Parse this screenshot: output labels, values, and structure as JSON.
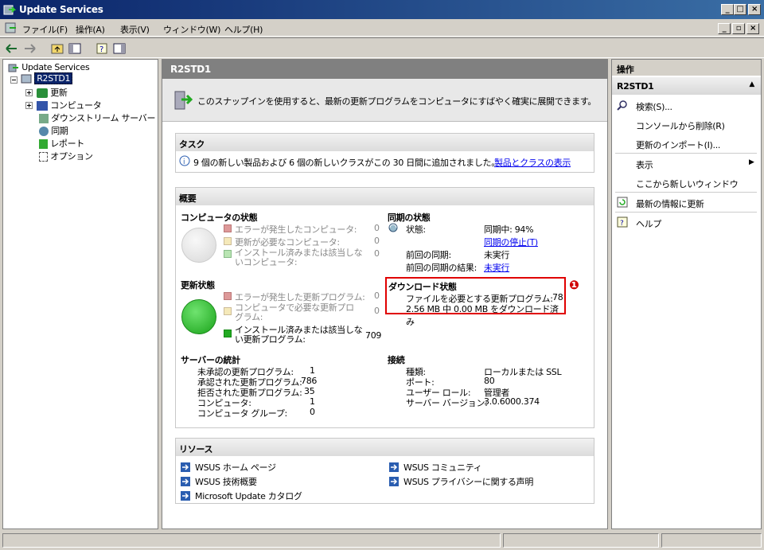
{
  "window": {
    "title": "Update Services"
  },
  "menu": [
    "ファイル(F)",
    "操作(A)",
    "表示(V)",
    "ウィンドウ(W)",
    "ヘルプ(H)"
  ],
  "tree": {
    "root": "Update Services",
    "server": "R2STD1",
    "items": [
      "更新",
      "コンピュータ",
      "ダウンストリーム サーバー",
      "同期",
      "レポート",
      "オプション"
    ]
  },
  "center": {
    "header": "R2STD1",
    "banner": "このスナップインを使用すると、最新の更新プログラムをコンピュータにすばやく確実に展開できます。",
    "tasks": {
      "title": "タスク",
      "message": "9 個の新しい製品および 6 個の新しいクラスがこの 30 日間に追加されました。",
      "link": "製品とクラスの表示"
    },
    "overview": {
      "title": "概要",
      "computer_status": {
        "title": "コンピュータの状態",
        "rows": [
          {
            "label": "エラーが発生したコンピュータ:",
            "value": "0"
          },
          {
            "label": "更新が必要なコンピュータ:",
            "value": "0"
          },
          {
            "label": "インストール済みまたは該当しないコンピュータ:",
            "value": "0"
          }
        ]
      },
      "update_status": {
        "title": "更新状態",
        "rows": [
          {
            "label": "エラーが発生した更新プログラム:",
            "value": "0"
          },
          {
            "label": "コンピュータで必要な更新プログラム:",
            "value": "0"
          },
          {
            "label": "インストール済みまたは該当しない更新プログラム:",
            "value": "709"
          }
        ]
      },
      "sync": {
        "title": "同期の状態",
        "status_label": "状態:",
        "status_value": "同期中: 94%",
        "stop_link": "同期の停止(T)",
        "last_label": "前回の同期:",
        "last_value": "未実行",
        "last_result_label": "前回の同期の結果:",
        "last_result_link": "未実行"
      },
      "download": {
        "title": "ダウンロード状態",
        "files_label": "ファイルを必要とする更新プログラム:",
        "files_value": "78",
        "progress": "2.56 MB 中 0.00 MB をダウンロード済み",
        "badge": "❶"
      },
      "server_stats": {
        "title": "サーバーの統計",
        "rows": [
          {
            "label": "未承認の更新プログラム:",
            "value": "1"
          },
          {
            "label": "承認された更新プログラム:",
            "value": "786"
          },
          {
            "label": "拒否された更新プログラム:",
            "value": "35"
          },
          {
            "label": "コンピュータ:",
            "value": "1"
          },
          {
            "label": "コンピュータ グループ:",
            "value": "0"
          }
        ]
      },
      "connection": {
        "title": "接続",
        "rows": [
          {
            "label": "種類:",
            "value": "ローカルまたは SSL"
          },
          {
            "label": "ポート:",
            "value": "80"
          },
          {
            "label": "ユーザー ロール:",
            "value": "管理者"
          },
          {
            "label": "サーバー バージョン:",
            "value": "3.0.6000.374"
          }
        ]
      }
    },
    "resources": {
      "title": "リソース",
      "links": [
        "WSUS ホーム ページ",
        "WSUS 技術概要",
        "Microsoft Update カタログ",
        "WSUS コミュニティ",
        "WSUS プライバシーに関する声明"
      ]
    }
  },
  "actions": {
    "title": "操作",
    "group": "R2STD1",
    "items": [
      "検索(S)...",
      "コンソールから削除(R)",
      "更新のインポート(I)...",
      "表示",
      "ここから新しいウィンドウ",
      "最新の情報に更新",
      "ヘルプ"
    ]
  }
}
